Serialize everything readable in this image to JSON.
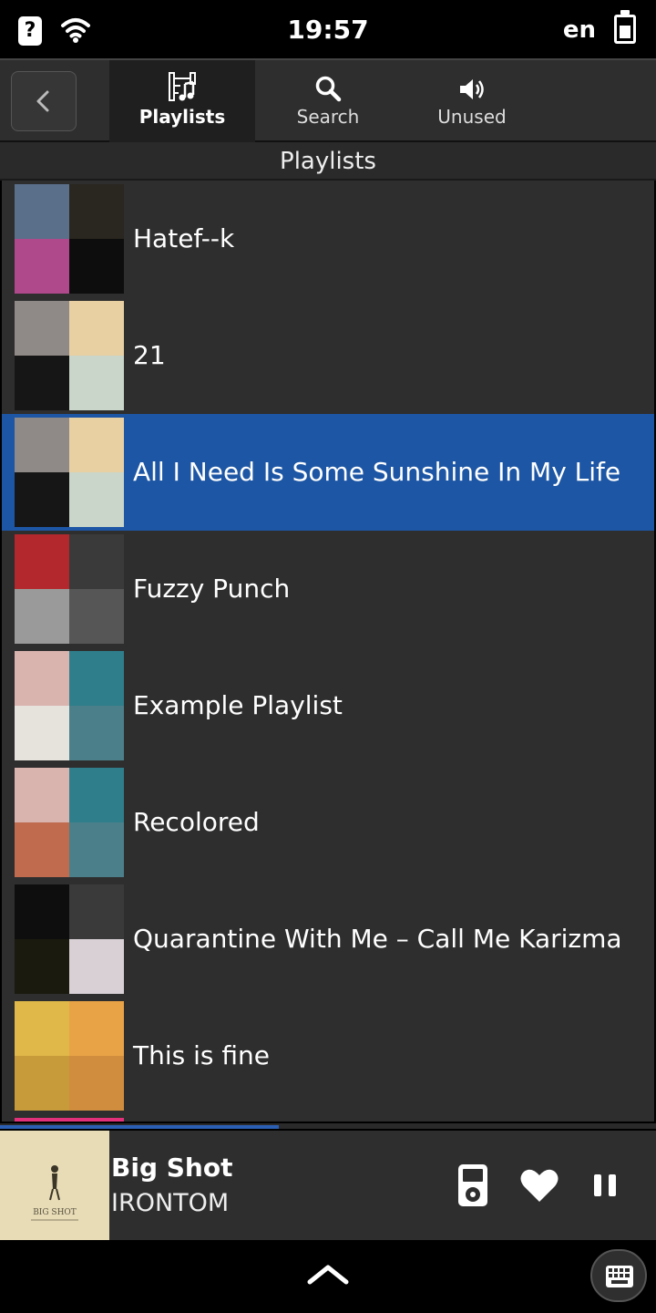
{
  "status_bar": {
    "time": "19:57",
    "language": "en",
    "help_glyph": "?"
  },
  "header": {
    "tabs": [
      {
        "label": "Playlists",
        "icon": "film-music-icon",
        "active": true
      },
      {
        "label": "Search",
        "icon": "search-icon",
        "active": false
      },
      {
        "label": "Unused",
        "icon": "speaker-icon",
        "active": false
      }
    ]
  },
  "section_title": "Playlists",
  "playlists": [
    {
      "name": "Hatef--k",
      "selected": false,
      "cover_colors": [
        "#5a6f8a",
        "#2a2620",
        "#b0488c",
        "#0d0d0d"
      ]
    },
    {
      "name": "21",
      "selected": false,
      "cover_colors": [
        "#8f8a87",
        "#e9d0a3",
        "#161616",
        "#c9d6c9"
      ]
    },
    {
      "name": "All I Need Is Some Sunshine In My Life",
      "selected": true,
      "cover_colors": [
        "#8f8a87",
        "#e9d0a3",
        "#161616",
        "#c9d6c9"
      ]
    },
    {
      "name": "Fuzzy Punch",
      "selected": false,
      "cover_colors": [
        "#b3282d",
        "#3a3a3a",
        "#9a9a9a",
        "#565656"
      ]
    },
    {
      "name": "Example Playlist",
      "selected": false,
      "cover_colors": [
        "#d9b3ae",
        "#2f7e8c",
        "#e6e2dc",
        "#4b7f8a"
      ]
    },
    {
      "name": "Recolored",
      "selected": false,
      "cover_colors": [
        "#d9b3ae",
        "#2f7e8c",
        "#c06a4e",
        "#4b7f8a"
      ]
    },
    {
      "name": "Quarantine With Me – Call Me Karizma",
      "selected": false,
      "cover_colors": [
        "#0e0e0e",
        "#3a3a3a",
        "#1a1a0e",
        "#d9d0d6"
      ]
    },
    {
      "name": "This is fine",
      "selected": false,
      "cover_colors": [
        "#e0b84a",
        "#e9a347",
        "#c79a3a",
        "#d08d3e"
      ]
    }
  ],
  "now_playing": {
    "title": "Big Shot",
    "artist": "IRONTOM",
    "art_text": "BIG SHOT",
    "progress": 0.425
  },
  "colors": {
    "accent": "#1d56a4",
    "background": "#2e2e2e",
    "progress": "#2b5fb3"
  },
  "icons": {
    "back": "chevron-left-icon",
    "device": "ipod-icon",
    "favorite": "heart-icon",
    "pause": "pause-icon",
    "expand": "chevron-up-icon",
    "keyboard": "keyboard-icon"
  }
}
